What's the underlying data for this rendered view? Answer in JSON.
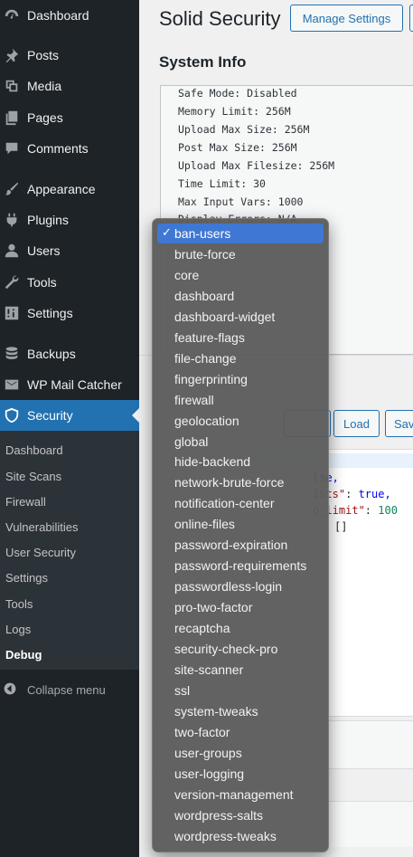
{
  "sidebar": {
    "items": [
      {
        "label": "Dashboard",
        "icon": "dashboard-icon"
      },
      {
        "label": "Posts",
        "icon": "pin-icon"
      },
      {
        "label": "Media",
        "icon": "media-icon"
      },
      {
        "label": "Pages",
        "icon": "pages-icon"
      },
      {
        "label": "Comments",
        "icon": "comment-icon"
      },
      {
        "label": "Appearance",
        "icon": "brush-icon"
      },
      {
        "label": "Plugins",
        "icon": "plug-icon"
      },
      {
        "label": "Users",
        "icon": "user-icon"
      },
      {
        "label": "Tools",
        "icon": "wrench-icon"
      },
      {
        "label": "Settings",
        "icon": "sliders-icon"
      },
      {
        "label": "Backups",
        "icon": "database-icon"
      },
      {
        "label": "WP Mail Catcher",
        "icon": "envelope-icon"
      },
      {
        "label": "Security",
        "icon": "shield-icon"
      }
    ],
    "submenu": [
      {
        "label": "Dashboard"
      },
      {
        "label": "Site Scans"
      },
      {
        "label": "Firewall"
      },
      {
        "label": "Vulnerabilities"
      },
      {
        "label": "User Security"
      },
      {
        "label": "Settings"
      },
      {
        "label": "Tools"
      },
      {
        "label": "Logs"
      },
      {
        "label": "Debug"
      }
    ],
    "collapse_label": "Collapse menu"
  },
  "header": {
    "title": "Solid Security",
    "manage_settings_label": "Manage Settings"
  },
  "system_info": {
    "title": "System Info",
    "lines": [
      "Safe Mode: Disabled",
      "Memory Limit: 256M",
      "Upload Max Size: 256M",
      "Post Max Size: 256M",
      "Upload Max Filesize: 256M",
      "Time Limit: 30",
      "Max Input Vars: 1000"
    ],
    "partial_line": "Display Errors: N/A"
  },
  "settings_editor": {
    "load_label": "Load",
    "save_label": "Sav",
    "json_fragments": {
      "line1_tail": "lse,",
      "line2_key": "ists\"",
      "line2_value": "true,",
      "line3_key": "g_limit\"",
      "line3_value": "100",
      "line4": "[]"
    }
  },
  "dropdown": {
    "selected": "ban-users",
    "options": [
      "ban-users",
      "brute-force",
      "core",
      "dashboard",
      "dashboard-widget",
      "feature-flags",
      "file-change",
      "fingerprinting",
      "firewall",
      "geolocation",
      "global",
      "hide-backend",
      "network-brute-force",
      "notification-center",
      "online-files",
      "password-expiration",
      "password-requirements",
      "passwordless-login",
      "pro-two-factor",
      "recaptcha",
      "security-check-pro",
      "site-scanner",
      "ssl",
      "system-tweaks",
      "two-factor",
      "user-groups",
      "user-logging",
      "version-management",
      "wordpress-salts",
      "wordpress-tweaks"
    ]
  },
  "colors": {
    "sidebar_bg": "#1d2327",
    "active_bg": "#2271b1",
    "selected_option_bg": "#3f78d4"
  }
}
